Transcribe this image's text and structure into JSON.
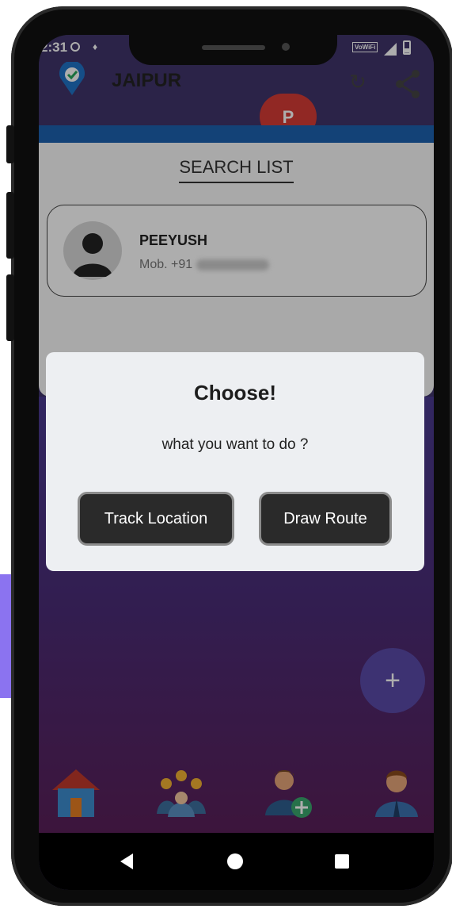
{
  "status_bar": {
    "time": "2:31",
    "network_badge": "VoWiFi"
  },
  "app_bar": {
    "city": "JAIPUR",
    "profile_initial": "P",
    "refresh_icon": "refresh-icon",
    "share_icon": "share-icon"
  },
  "search_list": {
    "title": "SEARCH LIST",
    "contact": {
      "name": "PEEYUSH",
      "phone_prefix": "Mob. +91"
    }
  },
  "dialog": {
    "title": "Choose!",
    "message": "what you want to do ?",
    "track_button": "Track Location",
    "draw_button": "Draw Route"
  },
  "fab": {
    "label": "+"
  },
  "bottom_nav": {
    "items": [
      "home-icon",
      "group-icon",
      "add-person-icon",
      "profile-icon"
    ]
  },
  "colors": {
    "accent_strip": "#8b73f0",
    "profile_badge": "#d63b35",
    "header_band": "#1c62b0",
    "fab": "#5a4aa8",
    "dialog_bg": "#edeff2",
    "dialog_button": "#2a2a2a"
  }
}
